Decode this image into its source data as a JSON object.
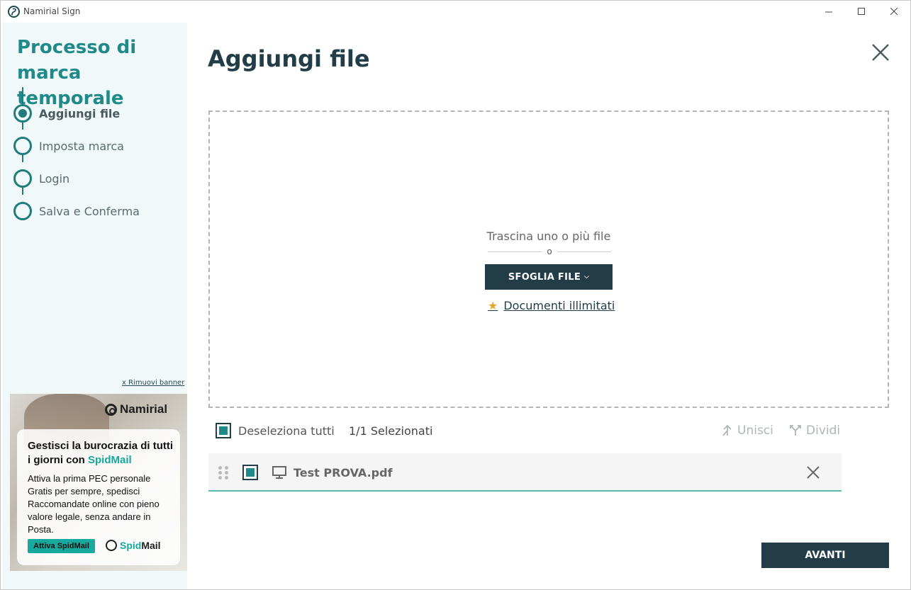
{
  "window": {
    "title": "Namirial Sign"
  },
  "sidebar": {
    "title": "Processo di marca temporale",
    "steps": [
      {
        "label": "Aggiungi file",
        "active": true
      },
      {
        "label": "Imposta marca",
        "active": false
      },
      {
        "label": "Login",
        "active": false
      },
      {
        "label": "Salva e Conferma",
        "active": false
      }
    ],
    "remove_banner": "x Rimuovi banner",
    "banner": {
      "brand": "Namirial",
      "headline_pre": "Gestisci la burocrazia di tutti i giorni con ",
      "headline_brand": "SpidMail",
      "body": "Attiva la prima PEC personale Gratis per sempre, spedisci Raccomandate online con pieno valore legale, senza andare in Posta.",
      "cta": "Attiva SpidMail",
      "logo_a": "Spid",
      "logo_b": "Mail"
    }
  },
  "main": {
    "title": "Aggiungi file",
    "dropzone": {
      "drag_text": "Trascina uno o più file",
      "or": "o",
      "browse_label": "SFOGLIA FILE",
      "unlimited_label": "Documenti illimitati"
    },
    "toolbar": {
      "deselect_all": "Deseleziona tutti",
      "selected_count": "1/1 Selezionati",
      "merge": "Unisci",
      "split": "Dividi"
    },
    "files": [
      {
        "name": "Test PROVA.pdf",
        "selected": true
      }
    ],
    "next_label": "AVANTI"
  },
  "colors": {
    "accent": "#1f8a88",
    "dark": "#233d48",
    "sidebar_bg": "#f0f8f9"
  }
}
